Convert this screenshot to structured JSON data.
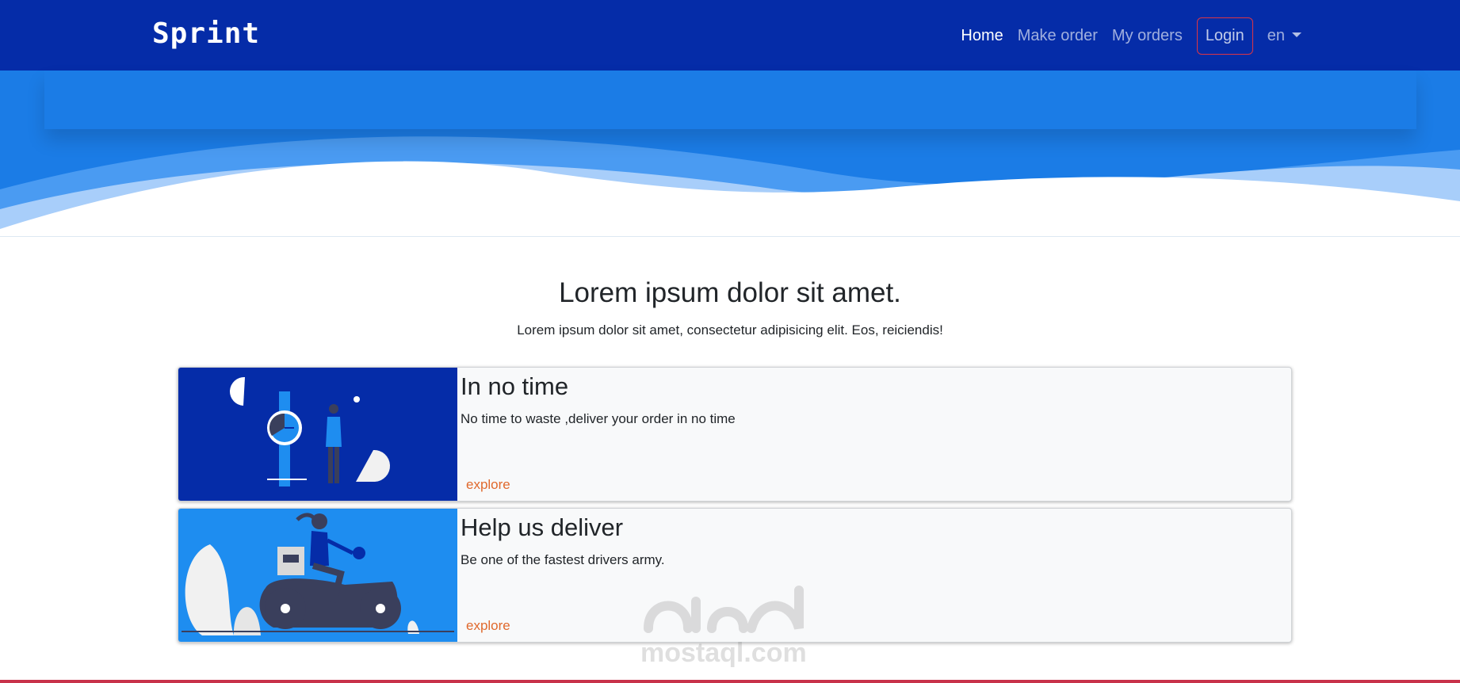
{
  "nav": {
    "brand": "Sprint",
    "links": [
      {
        "label": "Home"
      },
      {
        "label": "Make order"
      },
      {
        "label": "My orders"
      },
      {
        "label": "Login"
      },
      {
        "label": "en"
      }
    ]
  },
  "section": {
    "title": "Lorem ipsum dolor sit amet.",
    "subtitle": "Lorem ipsum dolor sit amet, consectetur adipisicing elit. Eos, reiciendis!"
  },
  "cards": [
    {
      "title": "In no time",
      "text": "No time to waste ,deliver your order in no time",
      "link": "explore"
    },
    {
      "title": "Help us deliver",
      "text": "Be one of the fastest drivers army.",
      "link": "explore"
    }
  ],
  "watermark": {
    "text": "mostaql.com"
  },
  "colors": {
    "navbar": "#052ca8",
    "hero": "#1b7ce6",
    "card_bg": "#f8f9fa",
    "link": "#e0692d",
    "login_border": "#dc3545"
  }
}
